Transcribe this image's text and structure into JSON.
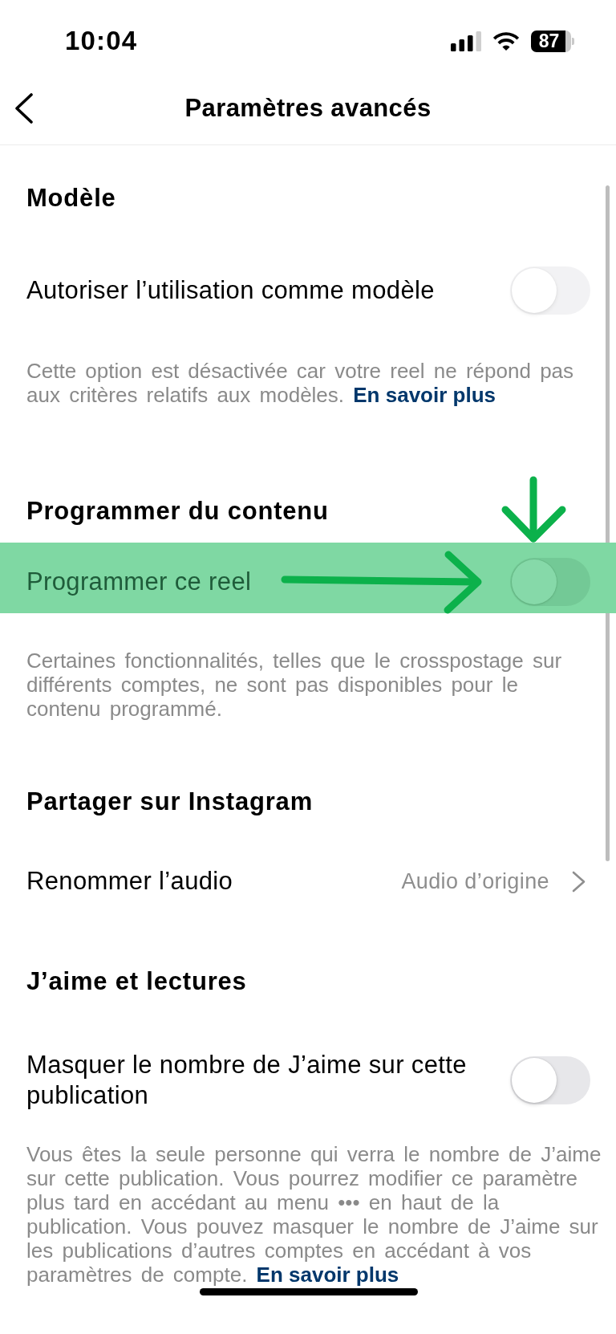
{
  "status_bar": {
    "time": "10:04",
    "battery": "87"
  },
  "header": {
    "title": "Paramètres avancés"
  },
  "sections": [
    {
      "heading": "Modèle",
      "rows": [
        {
          "kind": "toggle",
          "label": "Autoriser l’utilisation comme modèle",
          "on": false,
          "disabled": true,
          "highlighted": false
        }
      ],
      "description": {
        "text": "Cette option est désactivée car votre reel ne répond pas aux critères relatifs aux modèles.",
        "link": "En savoir plus"
      }
    },
    {
      "heading": "Programmer du contenu",
      "rows": [
        {
          "kind": "toggle",
          "label": "Programmer ce reel",
          "on": false,
          "disabled": false,
          "highlighted": true
        }
      ],
      "description": {
        "text": "Certaines fonctionnalités, telles que le crosspostage sur différents comptes, ne sont pas disponibles pour le contenu programmé."
      }
    },
    {
      "heading": "Partager sur Instagram",
      "rows": [
        {
          "kind": "link",
          "label": "Renommer l’audio",
          "value": "Audio d’origine",
          "highlighted": false
        }
      ]
    },
    {
      "heading": "J’aime et lectures",
      "rows": [
        {
          "kind": "toggle",
          "label": "Masquer le nombre de J’aime sur cette publication",
          "on": false,
          "disabled": false,
          "highlighted": false
        }
      ],
      "description": {
        "text": "Vous êtes la seule personne qui verra le nombre de J’aime sur cette publication. Vous pourrez modifier ce paramètre plus tard en accédant au menu ••• en haut de la publication. Vous pouvez masquer le nombre de J’aime sur les publications d’autres comptes en accédant à vos paramètres de compte.",
        "link": "En savoir plus"
      }
    }
  ]
}
